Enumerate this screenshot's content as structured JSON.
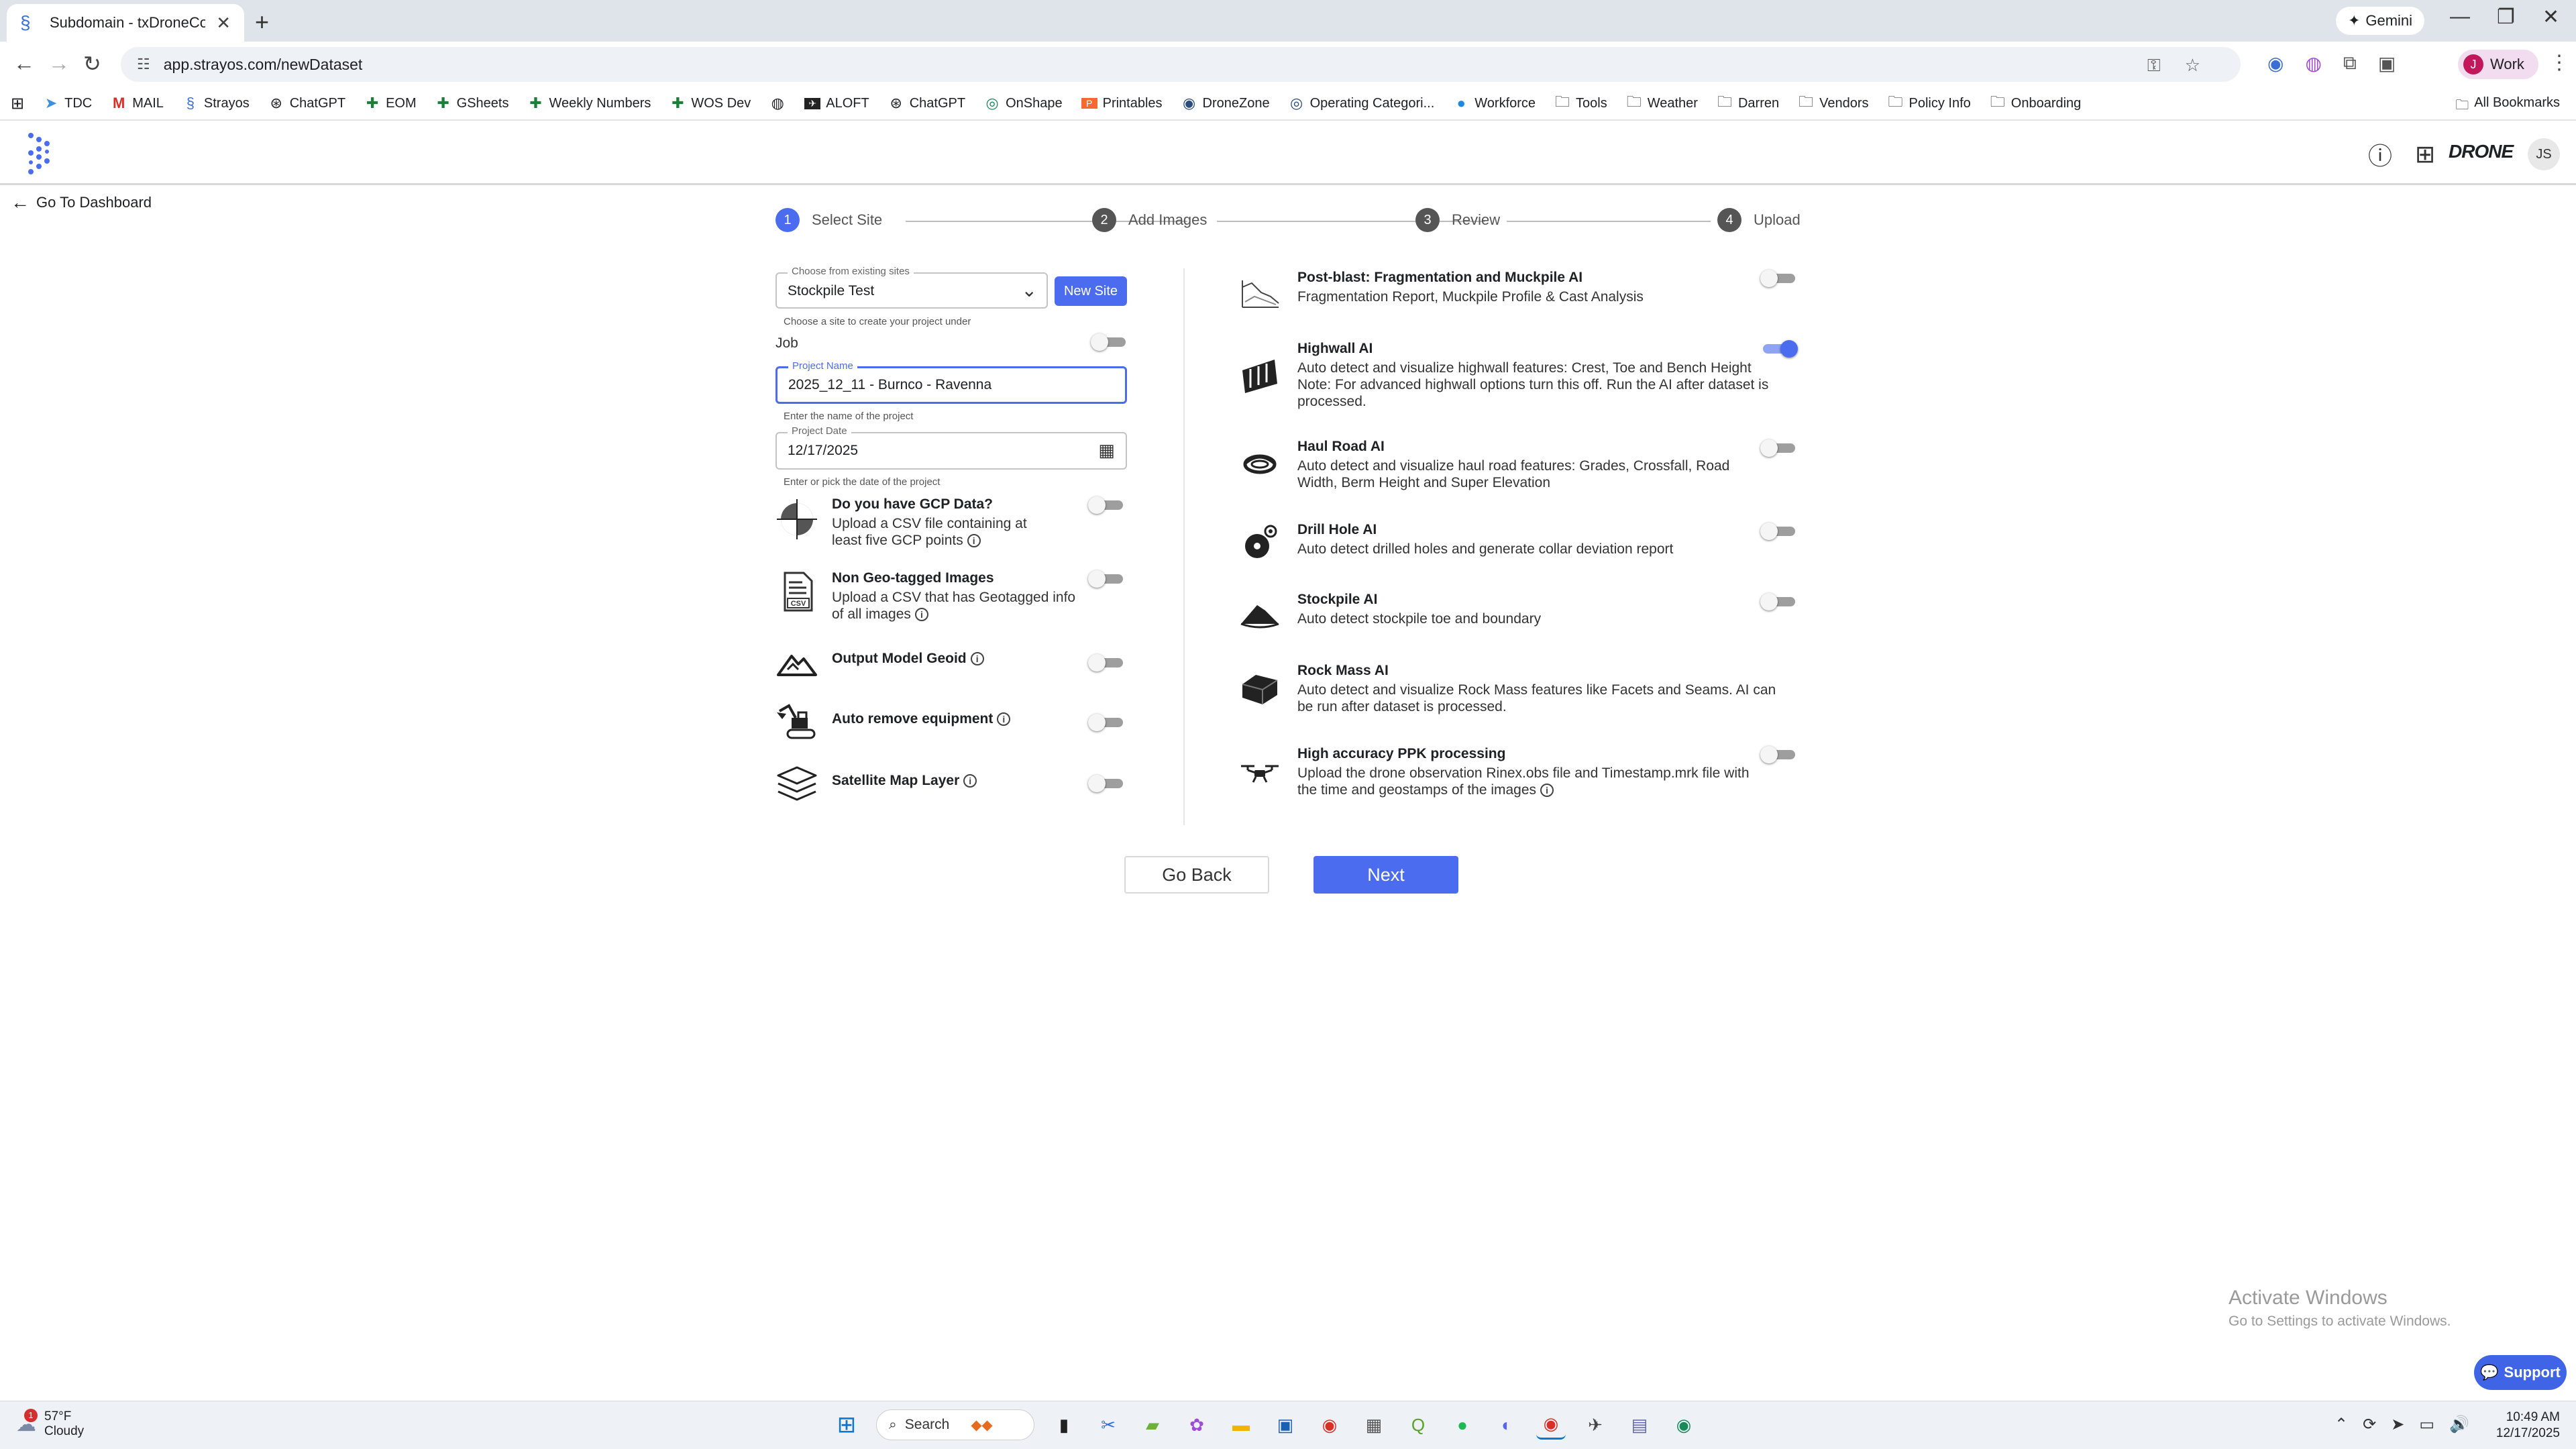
{
  "browser": {
    "tab_title": "Subdomain - txDroneCo - Dem",
    "url": "app.strayos.com/newDataset",
    "gemini_label": "Gemini",
    "profile_label": "Work",
    "profile_initial": "J",
    "bookmarks": [
      {
        "label": "TDC",
        "icon": "send-icon"
      },
      {
        "label": "MAIL",
        "icon": "gmail-icon"
      },
      {
        "label": "Strayos",
        "icon": "strayos-icon"
      },
      {
        "label": "ChatGPT",
        "icon": "chatgpt-icon"
      },
      {
        "label": "EOM",
        "icon": "sheets-icon"
      },
      {
        "label": "GSheets",
        "icon": "sheets-icon"
      },
      {
        "label": "Weekly Numbers",
        "icon": "sheets-icon"
      },
      {
        "label": "WOS Dev",
        "icon": "sheets-icon"
      },
      {
        "label": "",
        "icon": "globe-icon"
      },
      {
        "label": "ALOFT",
        "icon": "aloft-icon"
      },
      {
        "label": "ChatGPT",
        "icon": "chatgpt-icon"
      },
      {
        "label": "OnShape",
        "icon": "onshape-icon"
      },
      {
        "label": "Printables",
        "icon": "printables-icon"
      },
      {
        "label": "DroneZone",
        "icon": "dronezone-icon"
      },
      {
        "label": "Operating Categori...",
        "icon": "faa-icon"
      },
      {
        "label": "Workforce",
        "icon": "workforce-icon"
      },
      {
        "label": "Tools",
        "icon": "folder-icon"
      },
      {
        "label": "Weather",
        "icon": "folder-icon"
      },
      {
        "label": "Darren",
        "icon": "folder-icon"
      },
      {
        "label": "Vendors",
        "icon": "folder-icon"
      },
      {
        "label": "Policy Info",
        "icon": "folder-icon"
      },
      {
        "label": "Onboarding",
        "icon": "folder-icon"
      }
    ],
    "all_bookmarks": "All Bookmarks"
  },
  "app": {
    "brand_logo_text": "DRONE",
    "user_initials": "JS",
    "back_to_dashboard": "Go To Dashboard"
  },
  "stepper": [
    {
      "num": "1",
      "label": "Select Site",
      "active": true
    },
    {
      "num": "2",
      "label": "Add Images",
      "active": false
    },
    {
      "num": "3",
      "label": "Review",
      "active": false
    },
    {
      "num": "4",
      "label": "Upload",
      "active": false
    }
  ],
  "form": {
    "site_label": "Choose from existing sites",
    "site_value": "Stockpile Test",
    "new_site_button": "New Site",
    "site_helper": "Choose a site to create your project under",
    "job_label": "Job",
    "project_name_label": "Project Name",
    "project_name_value": "2025_12_11 - Burnco - Ravenna",
    "project_name_helper": "Enter the name of the project",
    "project_date_label": "Project Date",
    "project_date_value": "12/17/2025",
    "project_date_helper": "Enter or pick the date of the project"
  },
  "left_options": [
    {
      "title": "Do you have GCP Data?",
      "desc": "Upload a CSV file containing at least five GCP points",
      "icon": "gcp-crosshair-icon",
      "enabled": false
    },
    {
      "title": "Non Geo-tagged Images",
      "desc": "Upload a CSV that has Geotagged info of all images",
      "icon": "csv-file-icon",
      "enabled": false
    },
    {
      "title": "Output Model Geoid",
      "desc": "",
      "icon": "mountain-icon",
      "enabled": false
    },
    {
      "title": "Auto remove equipment",
      "desc": "",
      "icon": "excavator-icon",
      "enabled": false
    },
    {
      "title": "Satellite Map Layer",
      "desc": "",
      "icon": "layers-icon",
      "enabled": false
    }
  ],
  "right_options": [
    {
      "title": "Post-blast: Fragmentation and Muckpile AI",
      "desc": "Fragmentation Report, Muckpile Profile & Cast Analysis",
      "icon": "muckpile-icon",
      "enabled": false,
      "has_toggle": true
    },
    {
      "title": "Highwall AI",
      "desc": "Auto detect and visualize highwall features: Crest, Toe and Bench Height",
      "note": "Note: For advanced highwall options turn this off. Run the AI after dataset is processed.",
      "icon": "highwall-icon",
      "enabled": true,
      "has_toggle": true
    },
    {
      "title": "Haul Road AI",
      "desc": "Auto detect and visualize haul road features: Grades, Crossfall, Road Width, Berm Height and Super Elevation",
      "icon": "haul-road-icon",
      "enabled": false,
      "has_toggle": true
    },
    {
      "title": "Drill Hole AI",
      "desc": "Auto detect drilled holes and generate collar deviation report",
      "icon": "drill-hole-icon",
      "enabled": false,
      "has_toggle": true
    },
    {
      "title": "Stockpile AI",
      "desc": "Auto detect stockpile toe and boundary",
      "icon": "stockpile-icon",
      "enabled": false,
      "has_toggle": true
    },
    {
      "title": "Rock Mass AI",
      "desc": "Auto detect and visualize Rock Mass features like Facets and Seams. AI can be run after dataset is processed.",
      "icon": "rock-mass-icon",
      "enabled": false,
      "has_toggle": false
    },
    {
      "title": "High accuracy PPK processing",
      "desc": "Upload the drone observation Rinex.obs file and Timestamp.mrk file with the time and geostamps of the images",
      "icon": "drone-icon",
      "enabled": false,
      "has_toggle": true
    }
  ],
  "actions": {
    "back": "Go Back",
    "next": "Next"
  },
  "overlay": {
    "activate_title": "Activate Windows",
    "activate_sub": "Go to Settings to activate Windows.",
    "support": "Support"
  },
  "taskbar": {
    "temp": "57°F",
    "condition": "Cloudy",
    "weather_badge": "1",
    "search_label": "Search",
    "time": "10:49 AM",
    "date": "12/17/2025"
  },
  "colors": {
    "accent": "#4c6cf0",
    "support": "#3f64e6"
  }
}
